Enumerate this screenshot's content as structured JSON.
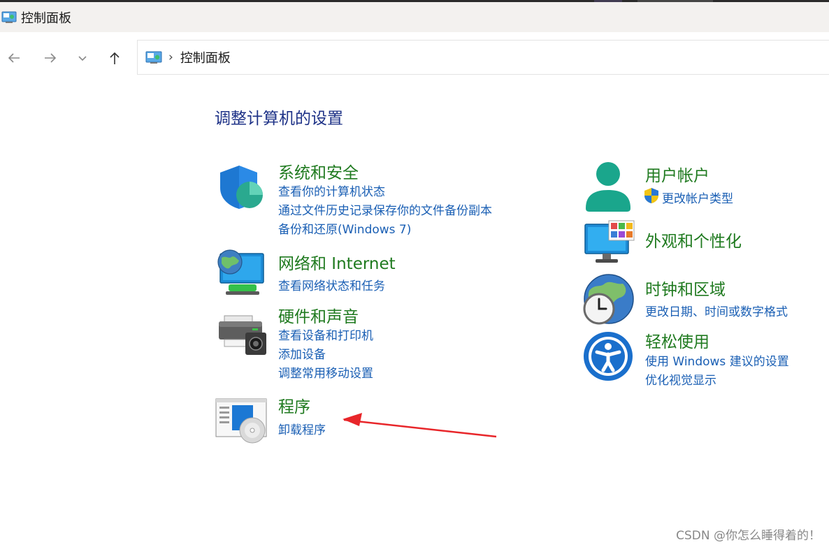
{
  "window": {
    "title": "控制面板"
  },
  "nav": {
    "address": "控制面板",
    "separator": "›"
  },
  "main": {
    "heading": "调整计算机的设置",
    "left": [
      {
        "title": "系统和安全",
        "icon": "shield-icon",
        "links": [
          "查看你的计算机状态",
          "通过文件历史记录保存你的文件备份副本",
          "备份和还原(Windows 7)"
        ]
      },
      {
        "title": "网络和 Internet",
        "icon": "network-icon",
        "links": [
          "查看网络状态和任务"
        ]
      },
      {
        "title": "硬件和声音",
        "icon": "printer-icon",
        "links": [
          "查看设备和打印机",
          "添加设备",
          "调整常用移动设置"
        ]
      },
      {
        "title": "程序",
        "icon": "programs-icon",
        "links": [
          "卸载程序"
        ]
      }
    ],
    "right": [
      {
        "title": "用户帐户",
        "icon": "user-icon",
        "links": [
          "更改帐户类型"
        ]
      },
      {
        "title": "外观和个性化",
        "icon": "monitor-icon",
        "links": []
      },
      {
        "title": "时钟和区域",
        "icon": "clock-globe-icon",
        "links": [
          "更改日期、时间或数字格式"
        ]
      },
      {
        "title": "轻松使用",
        "icon": "accessibility-icon",
        "links": [
          "使用 Windows 建议的设置",
          "优化视觉显示"
        ]
      }
    ]
  },
  "watermark": "CSDN @你怎么睡得着的！",
  "colors": {
    "category_title": "#1f7a1f",
    "link": "#1a5fb4",
    "heading": "#1e3287",
    "arrow": "#e8262a"
  }
}
